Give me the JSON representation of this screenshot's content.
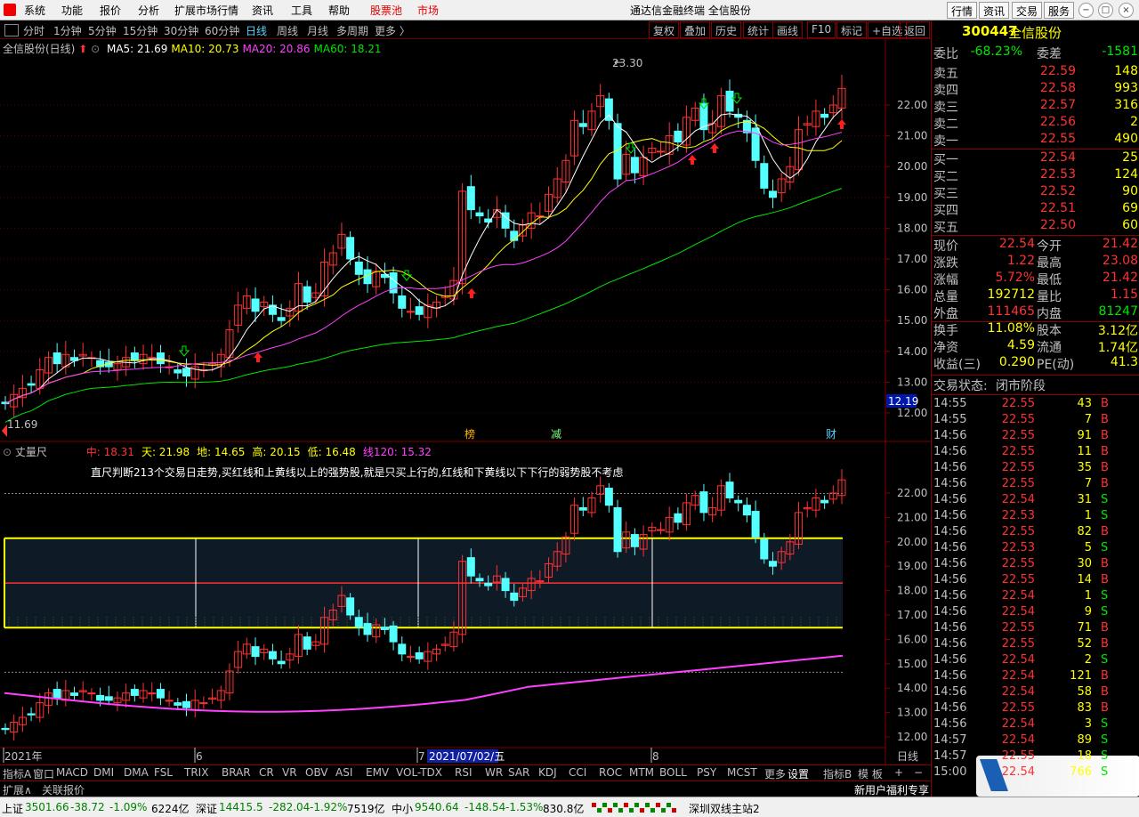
{
  "menubar": {
    "items": [
      "系统",
      "功能",
      "报价",
      "分析",
      "扩展市场行情",
      "资讯",
      "工具",
      "帮助"
    ],
    "pool": "股票池",
    "market": "市场",
    "title": "通达信金融终端  全信股份",
    "right_buttons": [
      "行情",
      "资讯",
      "交易",
      "服务"
    ]
  },
  "periodbar": {
    "periods": [
      "分时",
      "1分钟",
      "5分钟",
      "15分钟",
      "30分钟",
      "60分钟",
      "日线",
      "周线",
      "月线",
      "多周期",
      "更多 〉"
    ],
    "selected": "日线",
    "tools": [
      "复权",
      "叠加",
      "历史",
      "统计",
      "画线",
      "F10",
      "标记",
      "+自选",
      "返回"
    ]
  },
  "main_chart": {
    "title": "全信股份(日线)",
    "ma_labels": [
      {
        "text": "MA5: 21.69",
        "color": "#ffffff"
      },
      {
        "text": "MA10: 20.73",
        "color": "#ffff00"
      },
      {
        "text": "MA20: 20.86",
        "color": "#ff40ff"
      },
      {
        "text": "MA60: 18.21",
        "color": "#00e600"
      }
    ],
    "high_label": "23.30",
    "low_label": "11.69",
    "current_tag": "12.19",
    "y_ticks": [
      "22.00",
      "21.00",
      "20.00",
      "19.00",
      "18.00",
      "17.00",
      "16.00",
      "15.00",
      "14.00",
      "13.00",
      "12.00"
    ],
    "markers": [
      "榜",
      "减",
      "财"
    ]
  },
  "sub_chart": {
    "title": "丈量尺",
    "stats": [
      {
        "text": "中: 18.31",
        "color": "#ff3232"
      },
      {
        "text": "天: 21.98",
        "color": "#ffff00"
      },
      {
        "text": "地: 14.65",
        "color": "#ffff00"
      },
      {
        "text": "高: 20.15",
        "color": "#ffff00"
      },
      {
        "text": "低: 16.48",
        "color": "#ffff00"
      },
      {
        "text": "线120: 15.32",
        "color": "#ff40ff"
      }
    ],
    "note": "直尺判断213个交易日走势,买红线和上黄线以上的强势股,就是只买上行的,红线和下黄线以下下行的弱势股不考虑",
    "y_ticks": [
      "22.00",
      "21.00",
      "20.00",
      "19.00",
      "18.00",
      "17.00",
      "16.00",
      "15.00",
      "14.00",
      "13.00",
      "12.00"
    ],
    "x_labels": [
      "2021年",
      "6",
      "7",
      "2021/07/02/五",
      "8"
    ],
    "period_label": "日线"
  },
  "indicator_bar": {
    "items": [
      "指标A",
      "窗口",
      "MACD",
      "DMI",
      "DMA",
      "FSL",
      "TRIX",
      "BRAR",
      "CR",
      "VR",
      "OBV",
      "ASI",
      "EMV",
      "VOL-TDX",
      "RSI",
      "WR",
      "SAR",
      "KDJ",
      "CCI",
      "ROC",
      "MTM",
      "BOLL",
      "PSY",
      "MCST",
      "更多",
      "设置"
    ],
    "right": [
      "指标B",
      "模 板",
      "+",
      "−"
    ]
  },
  "ext_bar": {
    "left": [
      "扩展∧",
      "关联报价"
    ],
    "right": "新用户福利专享"
  },
  "quote": {
    "code": "300447",
    "name": "全信股份",
    "weibi_label": "委比",
    "weibi": "-68.23%",
    "weicha_label": "委差",
    "weicha": "-1581",
    "asks": [
      {
        "label": "卖五",
        "price": "22.59",
        "vol": "148"
      },
      {
        "label": "卖四",
        "price": "22.58",
        "vol": "993"
      },
      {
        "label": "卖三",
        "price": "22.57",
        "vol": "316"
      },
      {
        "label": "卖二",
        "price": "22.56",
        "vol": "2"
      },
      {
        "label": "卖一",
        "price": "22.55",
        "vol": "490"
      }
    ],
    "bids": [
      {
        "label": "买一",
        "price": "22.54",
        "vol": "25"
      },
      {
        "label": "买二",
        "price": "22.53",
        "vol": "124"
      },
      {
        "label": "买三",
        "price": "22.52",
        "vol": "90"
      },
      {
        "label": "买四",
        "price": "22.51",
        "vol": "69"
      },
      {
        "label": "买五",
        "price": "22.50",
        "vol": "60"
      }
    ],
    "stats": [
      {
        "l1": "现价",
        "v1": "22.54",
        "c1": "#ff3232",
        "l2": "今开",
        "v2": "21.42",
        "c2": "#ff3232"
      },
      {
        "l1": "涨跌",
        "v1": "1.22",
        "c1": "#ff3232",
        "l2": "最高",
        "v2": "23.08",
        "c2": "#ff3232"
      },
      {
        "l1": "涨幅",
        "v1": "5.72%",
        "c1": "#ff3232",
        "l2": "最低",
        "v2": "21.42",
        "c2": "#ff3232"
      },
      {
        "l1": "总量",
        "v1": "192712",
        "c1": "#ffff00",
        "l2": "量比",
        "v2": "1.15",
        "c2": "#ff3232"
      },
      {
        "l1": "外盘",
        "v1": "111465",
        "c1": "#ff3232",
        "l2": "内盘",
        "v2": "81247",
        "c2": "#00e600"
      },
      {
        "l1": "换手",
        "v1": "11.08%",
        "c1": "#ffff00",
        "l2": "股本",
        "v2": "3.12亿",
        "c2": "#ffff00"
      },
      {
        "l1": "净资",
        "v1": "4.59",
        "c1": "#ffff00",
        "l2": "流通",
        "v2": "1.74亿",
        "c2": "#ffff00"
      },
      {
        "l1": "收益(三)",
        "v1": "0.290",
        "c1": "#ffff00",
        "l2": "PE(动)",
        "v2": "41.3",
        "c2": "#ffff00"
      }
    ],
    "status_label": "交易状态:",
    "status": "闭市阶段"
  },
  "ticks": [
    {
      "t": "14:55",
      "p": "22.55",
      "v": "43",
      "d": "B"
    },
    {
      "t": "14:55",
      "p": "22.55",
      "v": "7",
      "d": "B"
    },
    {
      "t": "14:56",
      "p": "22.55",
      "v": "91",
      "d": "B"
    },
    {
      "t": "14:56",
      "p": "22.55",
      "v": "11",
      "d": "B"
    },
    {
      "t": "14:56",
      "p": "22.55",
      "v": "35",
      "d": "B"
    },
    {
      "t": "14:56",
      "p": "22.55",
      "v": "7",
      "d": "B"
    },
    {
      "t": "14:56",
      "p": "22.54",
      "v": "31",
      "d": "S"
    },
    {
      "t": "14:56",
      "p": "22.53",
      "v": "1",
      "d": "S"
    },
    {
      "t": "14:56",
      "p": "22.55",
      "v": "82",
      "d": "B"
    },
    {
      "t": "14:56",
      "p": "22.53",
      "v": "5",
      "d": "S"
    },
    {
      "t": "14:56",
      "p": "22.55",
      "v": "30",
      "d": "B"
    },
    {
      "t": "14:56",
      "p": "22.55",
      "v": "14",
      "d": "B"
    },
    {
      "t": "14:56",
      "p": "22.54",
      "v": "1",
      "d": "S"
    },
    {
      "t": "14:56",
      "p": "22.54",
      "v": "9",
      "d": "S"
    },
    {
      "t": "14:56",
      "p": "22.55",
      "v": "71",
      "d": "B"
    },
    {
      "t": "14:56",
      "p": "22.55",
      "v": "52",
      "d": "B"
    },
    {
      "t": "14:56",
      "p": "22.54",
      "v": "2",
      "d": "S"
    },
    {
      "t": "14:56",
      "p": "22.54",
      "v": "121",
      "d": "B"
    },
    {
      "t": "14:56",
      "p": "22.54",
      "v": "58",
      "d": "B"
    },
    {
      "t": "14:56",
      "p": "22.55",
      "v": "83",
      "d": "B"
    },
    {
      "t": "14:56",
      "p": "22.54",
      "v": "3",
      "d": "S"
    },
    {
      "t": "14:57",
      "p": "22.54",
      "v": "89",
      "d": "S"
    },
    {
      "t": "14:57",
      "p": "22.55",
      "v": "18",
      "d": "S"
    },
    {
      "t": "15:00",
      "p": "22.54",
      "v": "766",
      "d": "S"
    }
  ],
  "statusbar": [
    {
      "text": "上证",
      "color": "#000000"
    },
    {
      "text": "3501.66",
      "color": "#008000"
    },
    {
      "text": "-38.72",
      "color": "#008000"
    },
    {
      "text": "-1.09%",
      "color": "#008000"
    },
    {
      "text": "6224亿",
      "color": "#000000"
    },
    {
      "text": "深证",
      "color": "#000000"
    },
    {
      "text": "14415.5",
      "color": "#008000"
    },
    {
      "text": "-282.04",
      "color": "#008000"
    },
    {
      "text": "-1.92%",
      "color": "#008000"
    },
    {
      "text": "7519亿",
      "color": "#000000"
    },
    {
      "text": "中小",
      "color": "#000000"
    },
    {
      "text": "9540.64",
      "color": "#008000"
    },
    {
      "text": "-148.54",
      "color": "#008000"
    },
    {
      "text": "-1.53%",
      "color": "#008000"
    },
    {
      "text": "830.8亿",
      "color": "#000000"
    },
    {
      "text": "深圳双线主站2",
      "color": "#000000"
    }
  ],
  "colors": {
    "up": "#ff3232",
    "down": "#54ffff",
    "ma5": "#ffffff",
    "ma10": "#ffff00",
    "ma20": "#ff40ff",
    "ma60": "#00e600",
    "grid": "#800000"
  }
}
